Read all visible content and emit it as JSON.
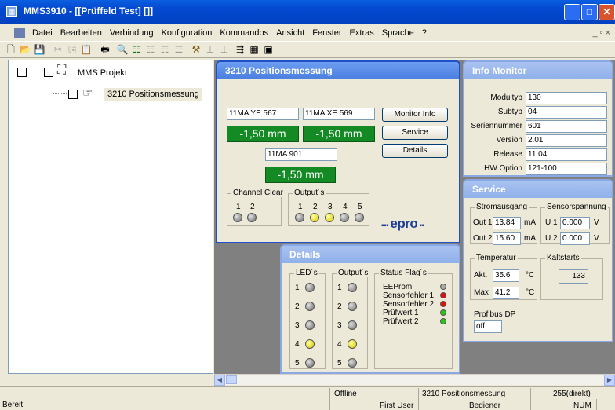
{
  "window": {
    "title": "MMS3910 - [[Prüffeld Test] []]"
  },
  "menu": [
    "Datei",
    "Bearbeiten",
    "Verbindung",
    "Konfiguration",
    "Kommandos",
    "Ansicht",
    "Fenster",
    "Extras",
    "Sprache",
    "?"
  ],
  "mdi_controls": "_ ▫ ×",
  "tree": {
    "root": "MMS Projekt",
    "child": "3210 Positionsmessung"
  },
  "position_window": {
    "title": "3210 Positionsmessung",
    "sensor1": {
      "name": "11MA YE 567",
      "value": "-1,50 mm"
    },
    "sensor2": {
      "name": "11MA XE 569",
      "value": "-1,50 mm"
    },
    "sensor3": {
      "name": "11MA 901",
      "value": "-1,50 mm"
    },
    "buttons": {
      "monitor_info": "Monitor Info",
      "service": "Service",
      "details": "Details"
    },
    "channel_clear": {
      "label": "Channel Clear",
      "numbers": [
        "1",
        "2"
      ]
    },
    "outputs": {
      "label": "Output´s",
      "numbers": [
        "1",
        "2",
        "3",
        "4",
        "5"
      ]
    },
    "logo": "epro"
  },
  "info_monitor": {
    "title": "Info Monitor",
    "rows": [
      {
        "label": "Modultyp",
        "value": "130"
      },
      {
        "label": "Subtyp",
        "value": "04"
      },
      {
        "label": "Seriennummer",
        "value": "601"
      },
      {
        "label": "Version",
        "value": "2.01"
      },
      {
        "label": "Release",
        "value": "11.04"
      },
      {
        "label": "HW Option",
        "value": "121-100"
      }
    ]
  },
  "service": {
    "title": "Service",
    "stromausgang": {
      "label": "Stromausgang",
      "out1_label": "Out 1",
      "out1_value": "13.84",
      "out2_label": "Out 2",
      "out2_value": "15.60",
      "unit": "mA"
    },
    "sensorspannung": {
      "label": "Sensorspannung",
      "u1_label": "U 1",
      "u1_value": "0.000",
      "u2_label": "U 2",
      "u2_value": "0.000",
      "unit": "V"
    },
    "temperatur": {
      "label": "Temperatur",
      "akt_label": "Akt.",
      "akt_value": "35.6",
      "max_label": "Max",
      "max_value": "41.2",
      "unit": "°C"
    },
    "kaltstarts": {
      "label": "Kaltstarts",
      "value": "133"
    },
    "profibus": {
      "label": "Profibus DP",
      "value": "off"
    }
  },
  "details": {
    "title": "Details",
    "leds": {
      "label": "LED´s",
      "numbers": [
        "1",
        "2",
        "3",
        "4",
        "5"
      ]
    },
    "outputs": {
      "label": "Output´s",
      "numbers": [
        "1",
        "2",
        "3",
        "4",
        "5"
      ]
    },
    "status_flags": {
      "label": "Status Flag´s",
      "items": [
        "EEProm",
        "Sensorfehler 1",
        "Sensorfehler 2",
        "Prüfwert 1",
        "Prüfwert 2"
      ]
    }
  },
  "statusbar": {
    "ready": "Bereit",
    "connection": "Offline",
    "user": "First User",
    "module": "3210 Positionsmessung",
    "role": "Bediener",
    "address": "255(direkt)",
    "num": "NUM"
  }
}
